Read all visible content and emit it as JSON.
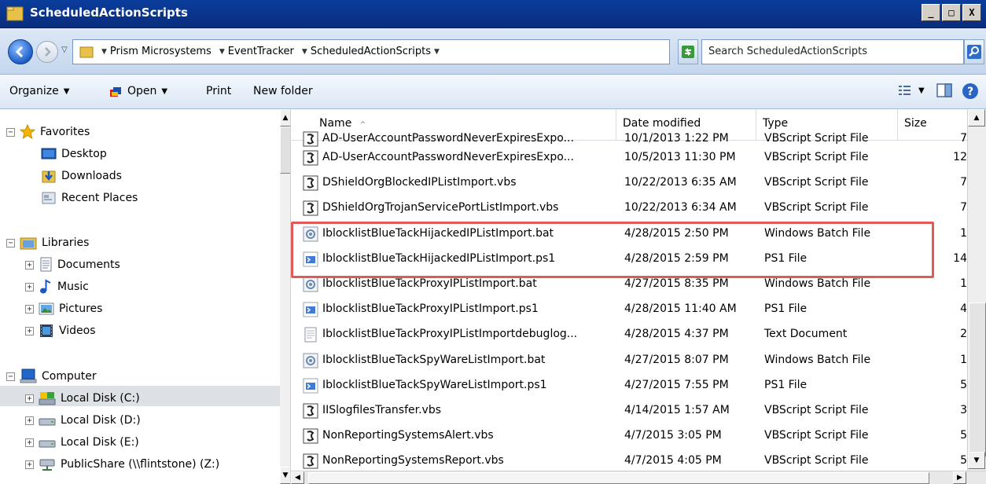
{
  "window": {
    "title": "ScheduledActionScripts",
    "min_label": "_",
    "max_label": "□",
    "close_label": "X"
  },
  "address": {
    "crumbs": [
      "Prism Microsystems",
      "EventTracker",
      "ScheduledActionScripts"
    ],
    "search_placeholder": "Search ScheduledActionScripts"
  },
  "toolbar": {
    "organize": "Organize",
    "open": "Open",
    "print": "Print",
    "new_folder": "New folder"
  },
  "nav": {
    "favorites": "Favorites",
    "desktop": "Desktop",
    "downloads": "Downloads",
    "recent": "Recent Places",
    "libraries": "Libraries",
    "documents": "Documents",
    "music": "Music",
    "pictures": "Pictures",
    "videos": "Videos",
    "computer": "Computer",
    "disk_c": "Local Disk (C:)",
    "disk_d": "Local Disk (D:)",
    "disk_e": "Local Disk (E:)",
    "publicshare": "PublicShare (\\\\flintstone) (Z:)"
  },
  "columns": {
    "name": "Name",
    "date": "Date modified",
    "type": "Type",
    "size": "Size"
  },
  "files": [
    {
      "name": "AD-UserAccountPasswordNeverExpiresExpo...",
      "date": "10/1/2013 1:22 PM",
      "type": "VBScript Script File",
      "size": "7",
      "icon": "vbs"
    },
    {
      "name": "AD-UserAccountPasswordNeverExpiresExpo...",
      "date": "10/5/2013 11:30 PM",
      "type": "VBScript Script File",
      "size": "12",
      "icon": "vbs"
    },
    {
      "name": "DShieldOrgBlockedIPListImport.vbs",
      "date": "10/22/2013 6:35 AM",
      "type": "VBScript Script File",
      "size": "7",
      "icon": "vbs"
    },
    {
      "name": "DShieldOrgTrojanServicePortListImport.vbs",
      "date": "10/22/2013 6:34 AM",
      "type": "VBScript Script File",
      "size": "7",
      "icon": "vbs"
    },
    {
      "name": "IblocklistBlueTackHijackedIPListImport.bat",
      "date": "4/28/2015 2:50 PM",
      "type": "Windows Batch File",
      "size": "1",
      "icon": "bat"
    },
    {
      "name": "IblocklistBlueTackHijackedIPListImport.ps1",
      "date": "4/28/2015 2:59 PM",
      "type": "PS1 File",
      "size": "14",
      "icon": "ps1"
    },
    {
      "name": "IblocklistBlueTackProxyIPListImport.bat",
      "date": "4/27/2015 8:35 PM",
      "type": "Windows Batch File",
      "size": "1",
      "icon": "bat"
    },
    {
      "name": "IblocklistBlueTackProxyIPListImport.ps1",
      "date": "4/28/2015 11:40 AM",
      "type": "PS1 File",
      "size": "4",
      "icon": "ps1"
    },
    {
      "name": "IblocklistBlueTackProxyIPListImportdebuglog...",
      "date": "4/28/2015 4:37 PM",
      "type": "Text Document",
      "size": "2",
      "icon": "txt"
    },
    {
      "name": "IblocklistBlueTackSpyWareListImport.bat",
      "date": "4/27/2015 8:07 PM",
      "type": "Windows Batch File",
      "size": "1",
      "icon": "bat"
    },
    {
      "name": "IblocklistBlueTackSpyWareListImport.ps1",
      "date": "4/27/2015 7:55 PM",
      "type": "PS1 File",
      "size": "5",
      "icon": "ps1"
    },
    {
      "name": "IISlogfilesTransfer.vbs",
      "date": "4/14/2015 1:57 AM",
      "type": "VBScript Script File",
      "size": "3",
      "icon": "vbs"
    },
    {
      "name": "NonReportingSystemsAlert.vbs",
      "date": "4/7/2015 3:05 PM",
      "type": "VBScript Script File",
      "size": "5",
      "icon": "vbs"
    },
    {
      "name": "NonReportingSystemsReport.vbs",
      "date": "4/7/2015 4:05 PM",
      "type": "VBScript Script File",
      "size": "5",
      "icon": "vbs"
    }
  ],
  "colors": {
    "highlight_border": "#e05a5a",
    "title_bar": "#0a3d9c"
  }
}
